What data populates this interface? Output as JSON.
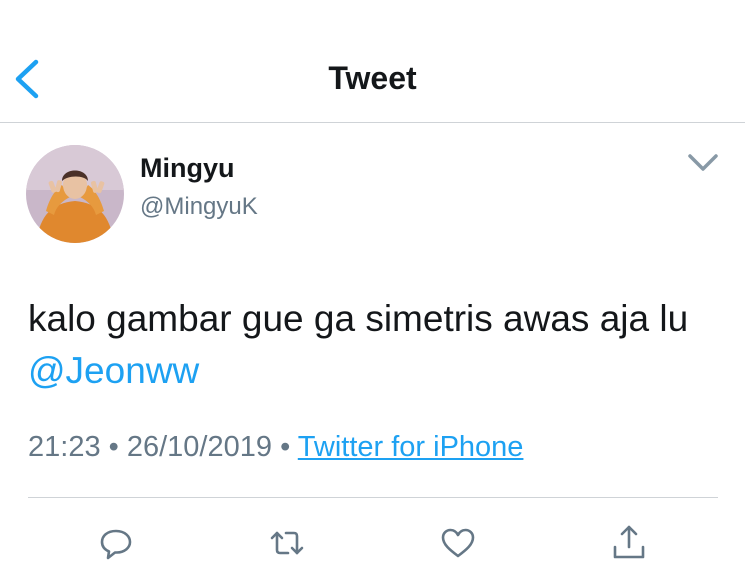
{
  "nav": {
    "title": "Tweet"
  },
  "tweet": {
    "display_name": "Mingyu",
    "handle": "@MingyuK",
    "text_before_mention": "kalo gambar gue ga simetris awas aja lu ",
    "mention": "@Jeonww",
    "time": "21:23",
    "date": "26/10/2019",
    "separator": "•",
    "source": "Twitter for iPhone"
  },
  "actions": [
    {
      "icon": "reply-icon"
    },
    {
      "icon": "retweet-icon"
    },
    {
      "icon": "like-icon"
    },
    {
      "icon": "share-icon"
    }
  ],
  "colors": {
    "accent": "#1da1f2",
    "secondary_text": "#657786",
    "primary_text": "#14171a",
    "divider": "#cfd3d7"
  }
}
